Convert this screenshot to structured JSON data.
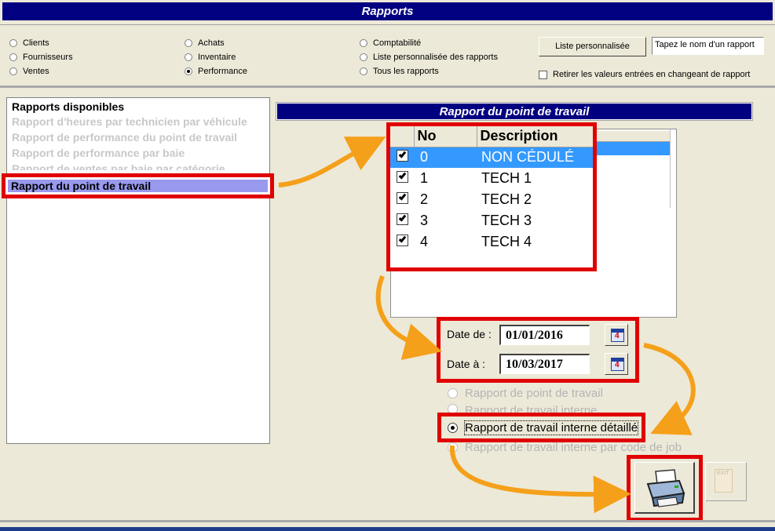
{
  "window": {
    "title": "Rapports"
  },
  "filters": {
    "col1": [
      {
        "label": "Clients",
        "selected": false
      },
      {
        "label": "Fournisseurs",
        "selected": false
      },
      {
        "label": "Ventes",
        "selected": false
      }
    ],
    "col2": [
      {
        "label": "Achats",
        "selected": false
      },
      {
        "label": "Inventaire",
        "selected": false
      },
      {
        "label": "Performance",
        "selected": true
      }
    ],
    "col3": [
      {
        "label": "Comptabilité",
        "selected": false
      },
      {
        "label": "Liste personnalisée des rapports",
        "selected": false
      },
      {
        "label": "Tous les rapports",
        "selected": false
      }
    ],
    "custom_list_button": "Liste personnalisée",
    "report_name_input": "Tapez le nom d'un rapport",
    "reset_checkbox_label": "Retirer les valeurs entrées en changeant de rapport",
    "reset_checked": false
  },
  "available_reports": {
    "header": "Rapports disponibles",
    "items": [
      "Rapport d'heures par technicien par véhicule",
      "Rapport de performance du point de travail",
      "Rapport de performance par baie",
      "Rapport de ventes par baie par catégorie",
      "Rapport du point de travail"
    ],
    "selected_index": 4
  },
  "report": {
    "title": "Rapport du point de travail",
    "table": {
      "columns": [
        "No",
        "Description"
      ],
      "rows": [
        {
          "no": "0",
          "description": "NON CÉDULÉ",
          "checked": true,
          "selected": true
        },
        {
          "no": "1",
          "description": "TECH 1",
          "checked": true,
          "selected": false
        },
        {
          "no": "2",
          "description": "TECH 2",
          "checked": true,
          "selected": false
        },
        {
          "no": "3",
          "description": "TECH 3",
          "checked": true,
          "selected": false
        },
        {
          "no": "4",
          "description": "TECH 4",
          "checked": true,
          "selected": false
        }
      ]
    },
    "date_from_label": "Date de :",
    "date_from": "01/01/2016",
    "date_to_label": "Date à :",
    "date_to": "10/03/2017",
    "report_types": [
      {
        "label": "Rapport de point de travail",
        "selected": false,
        "enabled": false
      },
      {
        "label": "Rapport de travail interne",
        "selected": false,
        "enabled": false
      },
      {
        "label": "Rapport de travail interne détaillé",
        "selected": true,
        "enabled": true
      },
      {
        "label": "Rapport de travail interne par code de job",
        "selected": false,
        "enabled": false
      }
    ],
    "exit_label": "EXIT"
  },
  "icons": {
    "print": "printer-icon",
    "exit": "exit-door-icon",
    "calendar": "calendar-icon"
  },
  "colors": {
    "title_bar": "#000080",
    "selection": "#3399ff",
    "list_selection": "#9999ee",
    "highlight": "#e00000",
    "arrow": "#f5a01a"
  }
}
